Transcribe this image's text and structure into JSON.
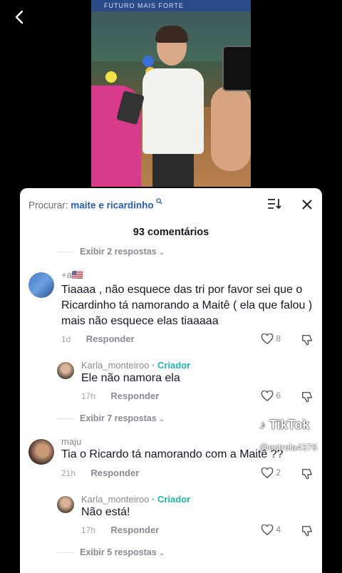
{
  "search": {
    "label": "Procurar:",
    "query": "maite e ricardinho"
  },
  "comments_count": "93 comentários",
  "expand_top": "Exibir 2 respostas",
  "comment1": {
    "username": "+a🇺🇸",
    "text": "Tiaaaa , não esquece das tri por favor sei que o Ricardinho tá namorando a Maitê ( ela que falou ) mais não esquece elas tiaaaaa",
    "time": "1d",
    "reply": "Responder",
    "likes": "8"
  },
  "reply1": {
    "username": "Karla_monteiroo",
    "creator_sep": " · ",
    "creator": "Criador",
    "text": "Ele não namora ela",
    "time": "17h",
    "reply": "Responder",
    "likes": "6"
  },
  "expand_mid": "Exibir 7 respostas",
  "comment2": {
    "username": "maju",
    "text": "Tia o Ricardo tá namorando com a Maitê ??",
    "time": "21h",
    "reply": "Responder",
    "likes": "2"
  },
  "reply2": {
    "username": "Karla_monteiroo",
    "creator_sep": " · ",
    "creator": "Criador",
    "text": "Não está!",
    "time": "17h",
    "reply": "Responder",
    "likes": "4"
  },
  "expand_bottom": "Exibir 5 respostas",
  "watermark": {
    "brand": "TikTok",
    "user": "@estrela4376"
  },
  "video_banner": "FUTURO MAIS FORTE"
}
